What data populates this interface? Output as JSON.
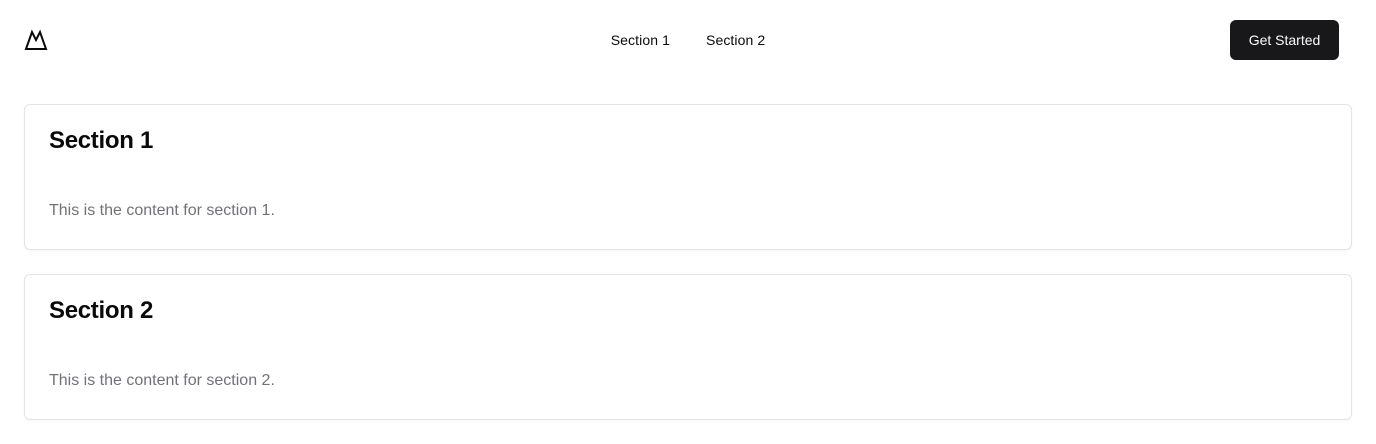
{
  "header": {
    "logo_icon": "mountain-icon",
    "nav": [
      {
        "label": "Section 1"
      },
      {
        "label": "Section 2"
      }
    ],
    "cta_label": "Get Started"
  },
  "sections": [
    {
      "title": "Section 1",
      "content": "This is the content for section 1."
    },
    {
      "title": "Section 2",
      "content": "This is the content for section 2."
    }
  ],
  "colors": {
    "primary": "#18181b",
    "muted_text": "#71717a",
    "border": "#e4e4e7"
  }
}
